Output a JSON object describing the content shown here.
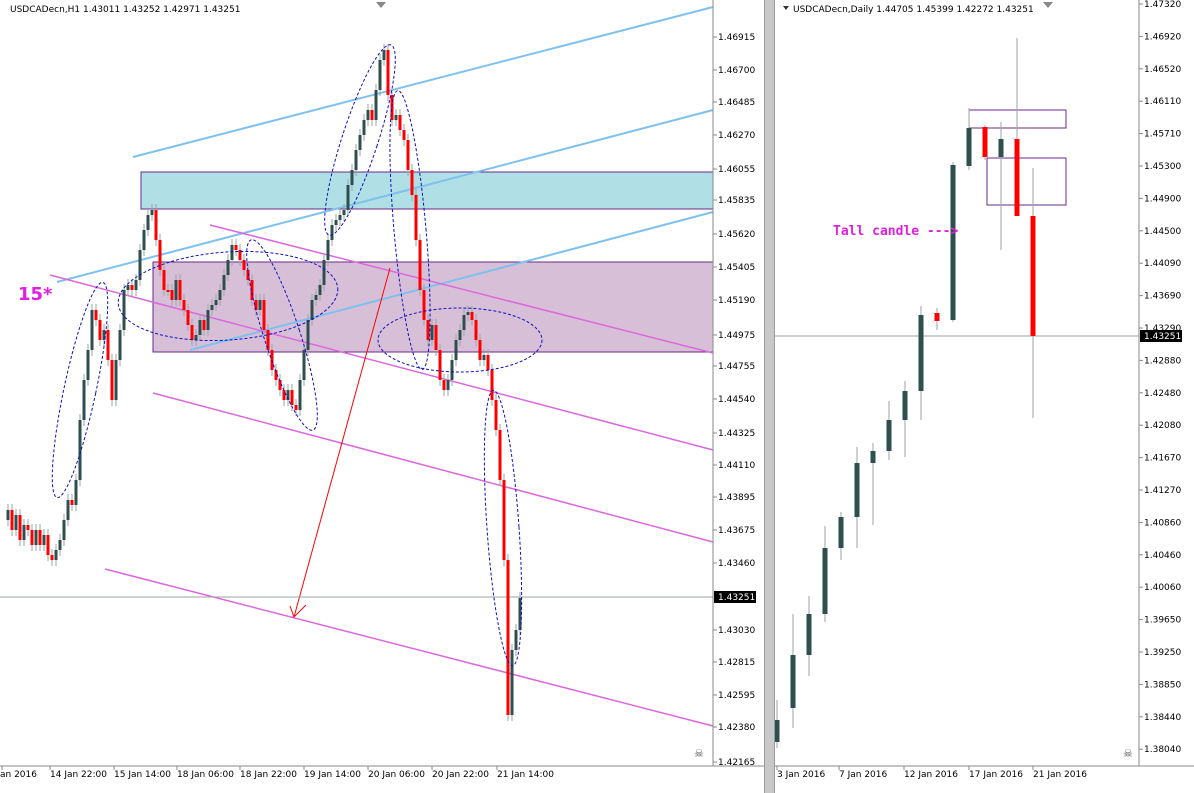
{
  "left_chart": {
    "title": "USDCADecn,H1  1.43011 1.43252 1.42971 1.43251",
    "price_labels": [
      "1.46915",
      "1.46700",
      "1.46485",
      "1.46270",
      "1.46055",
      "1.45835",
      "1.45620",
      "1.45405",
      "1.45190",
      "1.44975",
      "1.44755",
      "1.44540",
      "1.44325",
      "1.44110",
      "1.43895",
      "1.43675",
      "1.43460",
      "1.43030",
      "1.42815",
      "1.42595",
      "1.42380",
      "1.42165"
    ],
    "current_price": "1.43251",
    "time_labels": [
      "an 2016",
      "14 Jan 22:00",
      "15 Jan 14:00",
      "18 Jan 06:00",
      "18 Jan 22:00",
      "19 Jan 14:00",
      "20 Jan 06:00",
      "20 Jan 22:00",
      "21 Jan 14:00"
    ],
    "annotation": "15*",
    "colors": {
      "bull": "#2f4f4f",
      "bear": "#ff0000",
      "channel_blue": "#7ec0ee",
      "channel_pink": "#dd66dd",
      "zone_cyan": "#b0e0e6",
      "zone_purple": "#d8bfd8"
    }
  },
  "right_chart": {
    "title": "USDCADecn,Daily  1.44705 1.45399 1.42272 1.43251",
    "price_labels": [
      "1.47320",
      "1.46920",
      "1.46520",
      "1.46110",
      "1.45710",
      "1.45300",
      "1.44900",
      "1.44500",
      "1.44090",
      "1.43690",
      "1.43290",
      "1.42880",
      "1.42480",
      "1.42080",
      "1.41670",
      "1.41270",
      "1.40860",
      "1.40460",
      "1.40060",
      "1.39650",
      "1.39250",
      "1.38850",
      "1.38440",
      "1.38040"
    ],
    "current_price": "1.43251",
    "time_labels": [
      "3 Jan 2016",
      "7 Jan 2016",
      "12 Jan 2016",
      "17 Jan 2016",
      "21 Jan 2016"
    ],
    "annotation": "Tall candle --->"
  }
}
